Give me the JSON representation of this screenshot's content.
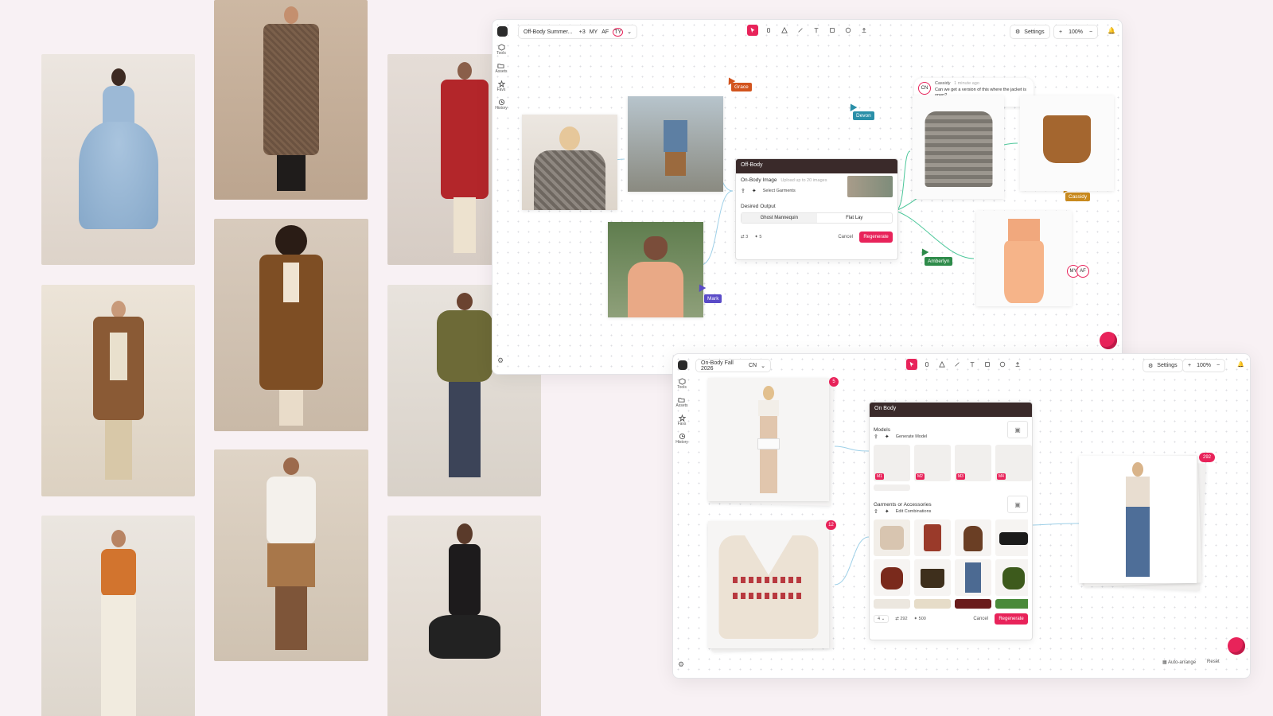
{
  "window1": {
    "project_title": "Off-Body Summer...",
    "collab_count": "+3",
    "collab_initials": [
      "MY",
      "AF",
      "TY"
    ],
    "settings_label": "Settings",
    "zoom": "100%",
    "sidebar": [
      {
        "label": "Tools",
        "icon": "cube-icon"
      },
      {
        "label": "Assets",
        "icon": "folder-icon"
      },
      {
        "label": "Favs",
        "icon": "star-icon"
      },
      {
        "label": "History",
        "icon": "history-icon"
      }
    ],
    "cursors": [
      {
        "name": "Grace",
        "color": "#d2541e"
      },
      {
        "name": "Devon",
        "color": "#2a8fa8"
      },
      {
        "name": "Cassidy",
        "color": "#c98a1e"
      },
      {
        "name": "Amberlyn",
        "color": "#2e8b4a"
      },
      {
        "name": "Mark",
        "color": "#5a4bc8"
      }
    ],
    "comment": {
      "initials": "CN",
      "author": "Cassidy",
      "time": "1 minute ago",
      "text": "Can we get a version of this where the jacket is open?"
    },
    "panel": {
      "title": "Off-Body",
      "image_label": "On-Body Image",
      "image_hint": "Upload up to 20 images",
      "select_garments": "Select Garments",
      "output_label": "Desired Output",
      "option_a": "Ghost Mannequin",
      "option_b": "Flat Lay",
      "count_a": "3",
      "count_b": "5",
      "cancel": "Cancel",
      "regenerate": "Regenerate"
    },
    "avatar_group": [
      "MY",
      "AF"
    ]
  },
  "window2": {
    "project_title": "On-Body Fall 2026",
    "collab": "CN",
    "settings_label": "Settings",
    "zoom": "100%",
    "sidebar": [
      {
        "label": "Tools",
        "icon": "cube-icon"
      },
      {
        "label": "Assets",
        "icon": "folder-icon"
      },
      {
        "label": "Favs",
        "icon": "star-icon"
      },
      {
        "label": "History",
        "icon": "history-icon"
      }
    ],
    "badge_models": "5",
    "badge_garments": "12",
    "badge_output": "292",
    "panel": {
      "title": "On Body",
      "models_label": "Models",
      "generate_model": "Generate Model",
      "model_tags": [
        "M1",
        "M2",
        "M3",
        "M4"
      ],
      "garments_label": "Garments or Accessories",
      "edit_combinations": "Edit Combinations",
      "count_select": "4",
      "count_a": "292",
      "count_b": "500",
      "cancel": "Cancel",
      "regenerate": "Regenerate"
    },
    "auto_arrange": "Auto-arrange",
    "reset": "Reset"
  },
  "colors": {
    "accent": "#e8235a",
    "panel_header": "#3a2a2a",
    "background": "#f8f1f4"
  }
}
